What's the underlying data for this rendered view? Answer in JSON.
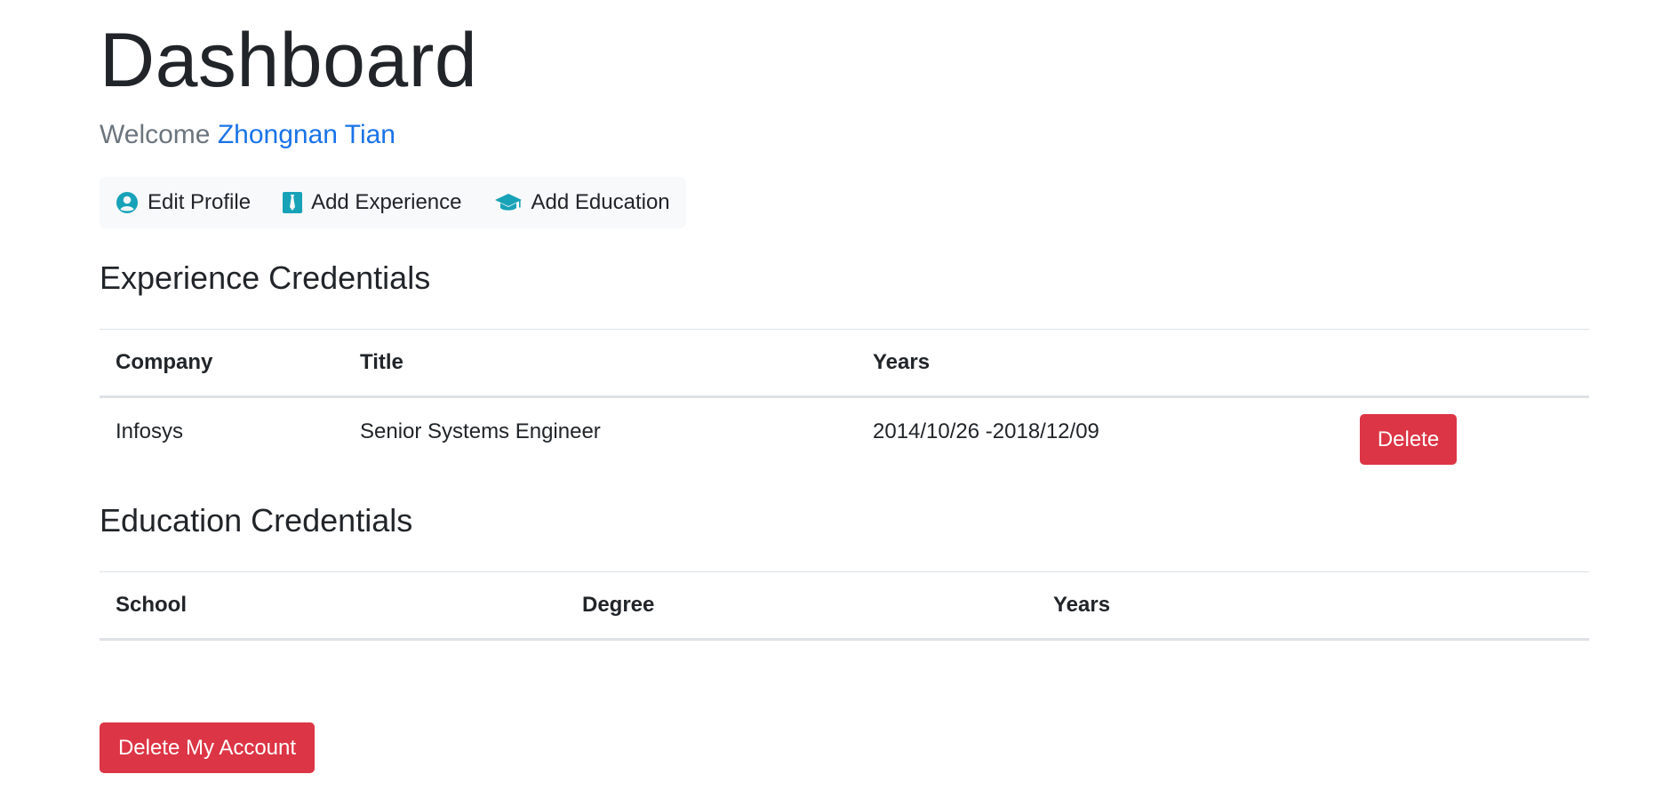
{
  "header": {
    "title": "Dashboard",
    "welcome_prefix": "Welcome",
    "user_name": "Zhongnan Tian"
  },
  "actions": {
    "edit_profile": "Edit Profile",
    "add_experience": "Add Experience",
    "add_education": "Add Education",
    "icons": [
      "user-circle-icon",
      "tie-icon",
      "graduation-cap-icon"
    ]
  },
  "experience": {
    "title": "Experience Credentials",
    "columns": [
      "Company",
      "Title",
      "Years"
    ],
    "rows": [
      {
        "company": "Infosys",
        "title": "Senior Systems Engineer",
        "years": "2014/10/26 -2018/12/09",
        "delete_label": "Delete"
      }
    ]
  },
  "education": {
    "title": "Education Credentials",
    "columns": [
      "School",
      "Degree",
      "Years"
    ],
    "rows": []
  },
  "footer": {
    "delete_account_label": "Delete My Account"
  },
  "colors": {
    "accent_icon": "#17a2b8",
    "danger": "#dc3545",
    "link": "#1a73e8",
    "muted": "#6c757d"
  }
}
